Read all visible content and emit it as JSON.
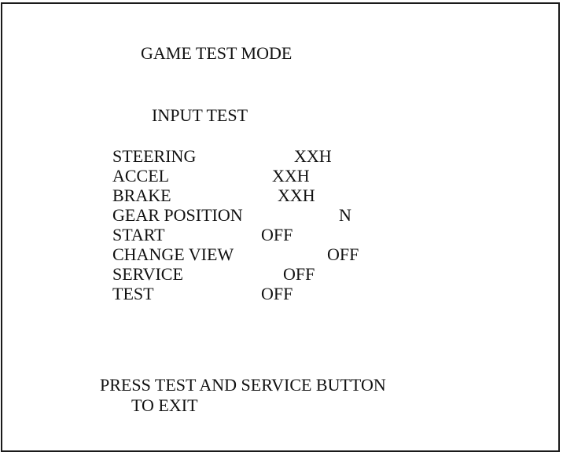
{
  "screen": {
    "title": "GAME TEST MODE",
    "subtitle": "INPUT TEST",
    "inputs": [
      {
        "label": "STEERING",
        "value": "XXH"
      },
      {
        "label": "ACCEL",
        "value": "XXH"
      },
      {
        "label": "BRAKE",
        "value": "XXH"
      },
      {
        "label": "GEAR POSITION",
        "value": "N"
      },
      {
        "label": "START",
        "value": "OFF"
      },
      {
        "label": "CHANGE VIEW",
        "value": "OFF"
      },
      {
        "label": "SERVICE",
        "value": "OFF"
      },
      {
        "label": "TEST",
        "value": "OFF"
      }
    ],
    "exit_line1": "PRESS TEST AND SERVICE BUTTON",
    "exit_line2": "TO EXIT"
  }
}
